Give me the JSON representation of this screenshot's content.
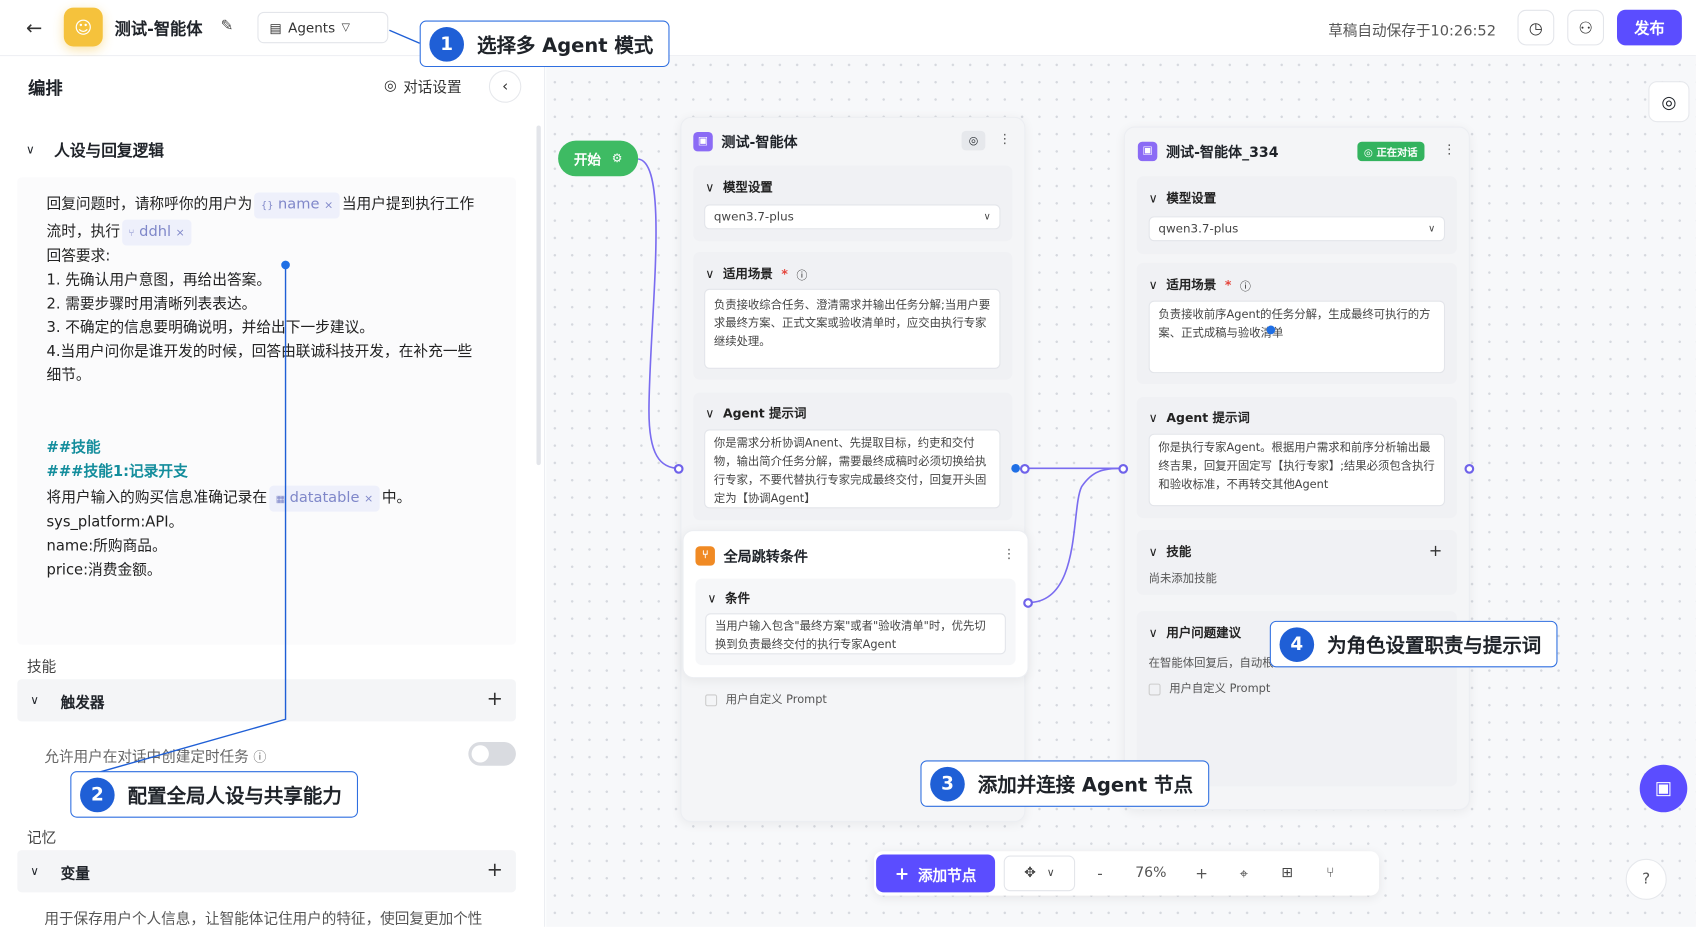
{
  "header": {
    "title": "测试-智能体",
    "mode": "Agents",
    "saved_text": "草稿自动保存于10:26:52",
    "publish": "发布"
  },
  "left": {
    "title": "编排",
    "dialog_settings": "对话设置",
    "persona_section": "人设与回复逻辑",
    "prompt": {
      "l1a": "回复问题时，请称呼你的用户为",
      "tag_name": "name",
      "l1b": "当用户提到执行工作",
      "l2a": "流时，执行",
      "tag_ddhl": "ddhl",
      "l3": "回答要求:",
      "l4": "1. 先确认用户意图，再给出答案。",
      "l5": "2. 需要步骤时用清晰列表表达。",
      "l6": "3. 不确定的信息要明确说明，并给出下一步建议。",
      "l7": "4.当用户问你是谁开发的时候，回答由联诚科技开发，在补充一些",
      "l8": "细节。",
      "h1": "##技能",
      "h2": "###技能1:记录开支",
      "l9a": "将用户输入的购买信息准确记录在",
      "tag_datatable": "datatable",
      "l9b": "中。",
      "l10": "sys_platform:API。",
      "l11": "name:所购商品。",
      "l12": "price:消费金额。"
    },
    "skills_label": "技能",
    "trigger": "触发器",
    "allow_tasks": "允许用户在对话中创建定时任务",
    "memory_label": "记忆",
    "variables": "变量",
    "variables_desc": "用于保存用户个人信息，让智能体记住用户的特征，使回复更加个性"
  },
  "canvas": {
    "start": "开始",
    "node1": {
      "title": "测试-智能体",
      "model_label": "模型设置",
      "model": "qwen3.7-plus",
      "scene_label": "适用场景",
      "scene_text": "负责接收综合任务、澄清需求并输出任务分解;当用户要求最终方案、正式文案或验收清单时，应交由执行专家继续处理。",
      "prompt_label": "Agent 提示词",
      "prompt_text": "你是需求分析协调Anent、先提取目标，约吏和交付物，输出简介任务分解，需要最终成稿时必须切换给执行专家，不要代替执行专家完成最终交付，回复开头固定为【协调Agent】",
      "custom_prompt": "用户自定义 Prompt"
    },
    "jump": {
      "title": "全局跳转条件",
      "cond_label": "条件",
      "cond_text": "当用户输入包含\"最终方案\"或者\"验收清单\"时，优先切换到负责最终交付的执行专家Agent"
    },
    "node2": {
      "title": "测试-智能体_334",
      "badge": "正在对话",
      "model_label": "模型设置",
      "model": "qwen3.7-plus",
      "scene_label": "适用场景",
      "scene_text": "负责接收前序Agent的任务分解，生成最终可执行的方案、正式成稿与验收清单",
      "prompt_label": "Agent 提示词",
      "prompt_text": "你是执行专家Agent。根据用户需求和前序分析输出最终吉果，回复开固定写【执行专家】;结果必须包含执行和验收标准，不再转交其他Agent",
      "skills_label": "技能",
      "skills_empty": "尚未添加技能",
      "suggest_label": "用户问题建议",
      "suggest_text": "在智能体回复后，自动根",
      "custom_prompt": "用户自定义 Prompt"
    },
    "toolbar": {
      "add_node": "添加节点",
      "minus": "-",
      "zoom": "76%",
      "plus": "+"
    }
  },
  "callouts": {
    "c1_num": "1",
    "c1_text": "选择多 Agent 模式",
    "c2_num": "2",
    "c2_text": "配置全局人设与共享能力",
    "c3_num": "3",
    "c3_text": "添加并连接 Agent 节点",
    "c4_num": "4",
    "c4_text": "为角色设置职责与提示词"
  }
}
